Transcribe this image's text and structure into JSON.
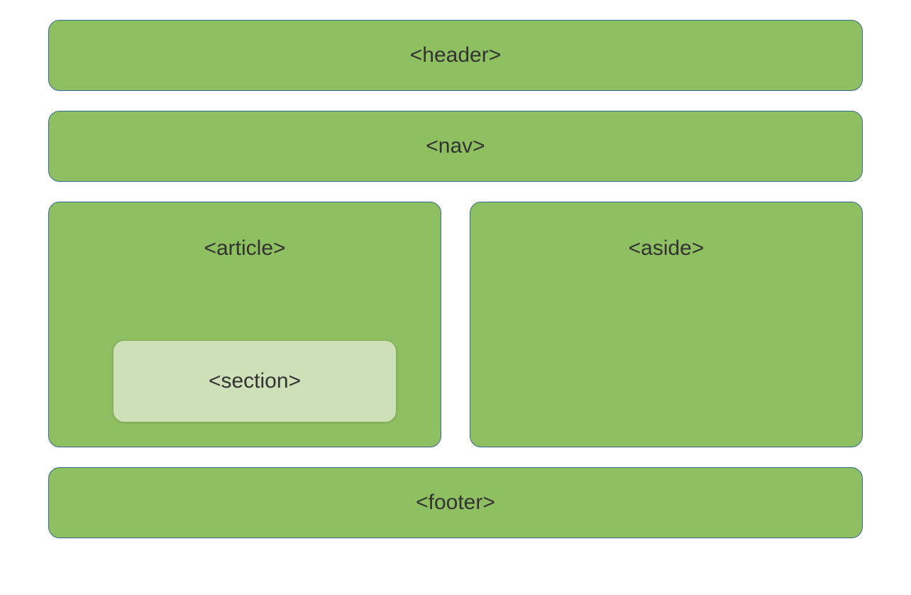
{
  "diagram": {
    "header_label": "<header>",
    "nav_label": "<nav>",
    "article_label": "<article>",
    "section_label": "<section>",
    "aside_label": "<aside>",
    "footer_label": "<footer>"
  }
}
